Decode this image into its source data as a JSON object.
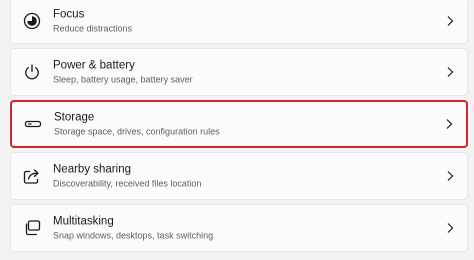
{
  "settings_list": {
    "items": [
      {
        "title": "Focus",
        "subtitle": "Reduce distractions",
        "icon": "focus-icon"
      },
      {
        "title": "Power & battery",
        "subtitle": "Sleep, battery usage, battery saver",
        "icon": "power-icon"
      },
      {
        "title": "Storage",
        "subtitle": "Storage space, drives, configuration rules",
        "icon": "storage-icon"
      },
      {
        "title": "Nearby sharing",
        "subtitle": "Discoverability, received files location",
        "icon": "share-icon"
      },
      {
        "title": "Multitasking",
        "subtitle": "Snap windows, desktops, task switching",
        "icon": "multitasking-icon"
      }
    ]
  },
  "colors": {
    "highlight_border": "#d4222b",
    "item_background": "#fbfbfb",
    "page_background": "#f3f3f3"
  }
}
